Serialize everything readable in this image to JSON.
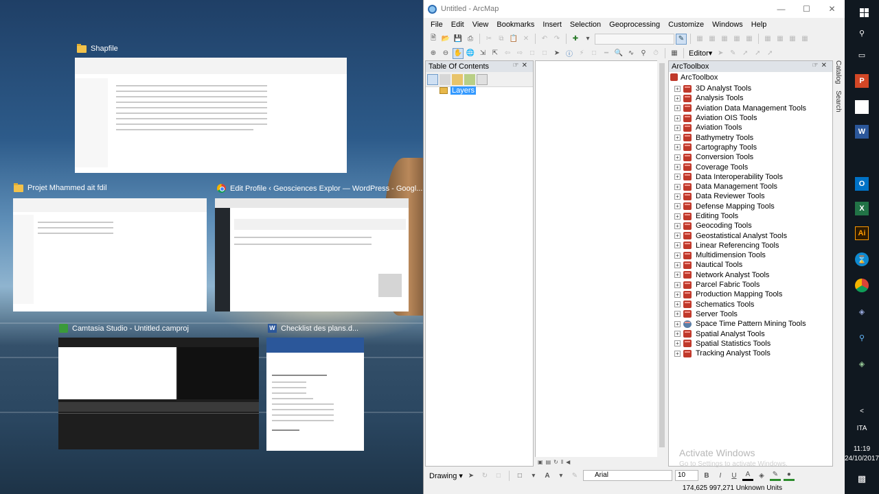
{
  "taskview": {
    "windows": [
      {
        "title": "Shapfile"
      },
      {
        "title": "Projet Mhammed ait fdil"
      },
      {
        "title": "Edit Profile ‹ Geosciences Explor — WordPress - Googl..."
      },
      {
        "title": "Camtasia Studio - Untitled.camproj"
      },
      {
        "title": "Checklist des plans.d..."
      }
    ]
  },
  "arcmap": {
    "title": "Untitled - ArcMap",
    "menus": [
      "File",
      "Edit",
      "View",
      "Bookmarks",
      "Insert",
      "Selection",
      "Geoprocessing",
      "Customize",
      "Windows",
      "Help"
    ],
    "editor_label": "Editor",
    "toc": {
      "title": "Table Of Contents",
      "layers_label": "Layers"
    },
    "toolbox": {
      "title": "ArcToolbox",
      "root": "ArcToolbox",
      "items": [
        "3D Analyst Tools",
        "Analysis Tools",
        "Aviation Data Management Tools",
        "Aviation OIS Tools",
        "Aviation Tools",
        "Bathymetry Tools",
        "Cartography Tools",
        "Conversion Tools",
        "Coverage Tools",
        "Data Interoperability Tools",
        "Data Management Tools",
        "Data Reviewer Tools",
        "Defense Mapping Tools",
        "Editing Tools",
        "Geocoding Tools",
        "Geostatistical Analyst Tools",
        "Linear Referencing Tools",
        "Multidimension Tools",
        "Nautical Tools",
        "Network Analyst Tools",
        "Parcel Fabric Tools",
        "Production Mapping Tools",
        "Schematics Tools",
        "Server Tools",
        "Space Time Pattern Mining Tools",
        "Spatial Analyst Tools",
        "Spatial Statistics Tools",
        "Tracking Analyst Tools"
      ]
    },
    "side_tabs": [
      "Catalog",
      "Search"
    ],
    "watermark": {
      "line1": "Activate Windows",
      "line2": "Go to Settings to activate Windows."
    },
    "drawing": {
      "label": "Drawing",
      "font": "Arial",
      "size": "10"
    },
    "status": "174,625  997,271 Unknown Units"
  },
  "taskbar": {
    "lang": "ITA",
    "time": "11:19",
    "date": "24/10/2017"
  }
}
